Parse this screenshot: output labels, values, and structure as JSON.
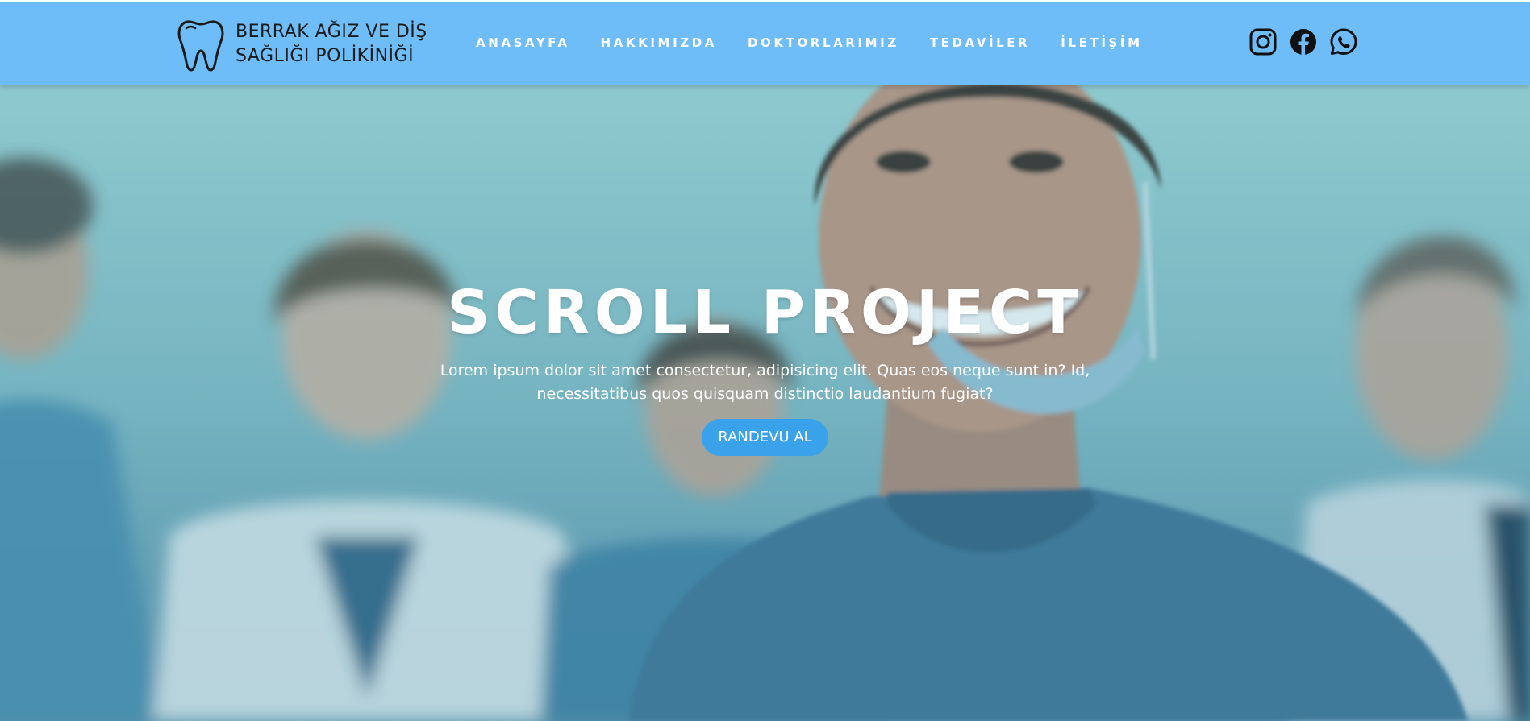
{
  "header": {
    "brand_line1": "BERRAK AĞIZ VE DİŞ",
    "brand_line2": "SAĞLIĞI POLİKİNİĞİ",
    "logo_icon": "tooth-icon",
    "nav": [
      {
        "label": "ANASAYFA"
      },
      {
        "label": "HAKKIMIZDA"
      },
      {
        "label": "DOKTORLARIMIZ"
      },
      {
        "label": "TEDAVİLER"
      },
      {
        "label": "İLETİŞİM"
      }
    ],
    "social": [
      {
        "icon": "instagram-icon"
      },
      {
        "icon": "facebook-icon"
      },
      {
        "icon": "whatsapp-icon"
      }
    ],
    "background_color": "#6ebdf8"
  },
  "hero": {
    "title": "SCROLL PROJECT",
    "text": "Lorem ipsum dolor sit amet consectetur, adipisicing elit. Quas eos neque sunt in? Id, necessitatibus quos quisquam distinctio laudantium fugiat?",
    "button_label": "RANDEVU AL",
    "button_color": "#3aa1eb",
    "background_image": "smiling-doctor-with-medical-team"
  }
}
